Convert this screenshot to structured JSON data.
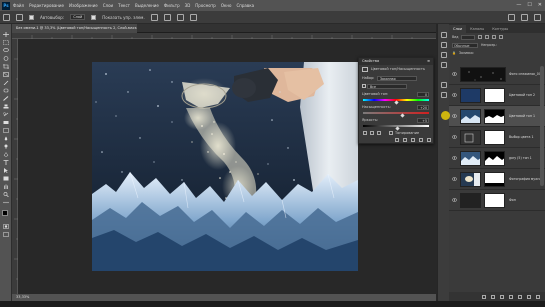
{
  "menu": {
    "items": [
      "Файл",
      "Редактирование",
      "Изображение",
      "Слои",
      "Текст",
      "Выделение",
      "Фильтр",
      "3D",
      "Просмотр",
      "Окно",
      "Справка"
    ],
    "window_controls": [
      "—",
      "☐",
      "✕"
    ]
  },
  "options": {
    "selection_label": "Автовыбор:",
    "selection_value": "Слой",
    "show_transform": "Показать упр. элем."
  },
  "document": {
    "tab_title": "Без имени-1 @ 33,3% (Цветовой тон/Насыщенность 2, Слой-маска/8) *",
    "status_text": "33,33%"
  },
  "properties": {
    "title": "Свойства",
    "subtitle": "Цветовой тон/Насыщенность",
    "preset_label": "Набор:",
    "preset_value": "Заказная",
    "channel_value": "Все",
    "hue_label": "Цветовой тон:",
    "hue_value": "0",
    "saturation_label": "Насыщенность:",
    "saturation_value": "+20",
    "lightness_label": "Яркость:",
    "lightness_value": "+5",
    "colorize_label": "Тонирование",
    "saturation_fraction": 0.6,
    "lightness_fraction": 0.53,
    "hue_fraction": 0.5
  },
  "layers_panel": {
    "tabs": [
      "Слои",
      "Каналы",
      "Контуры"
    ],
    "filter_label": "Вид",
    "blend_mode": "Обычные",
    "opacity_label": "Непрозр.:",
    "fill_label": "Заливка:",
    "layers": [
      {
        "name": "Фото снежинок_0001",
        "selected": false
      },
      {
        "name": "Цветовой тон 2",
        "selected": false
      },
      {
        "name": "Цветовой тон 1",
        "selected": true
      },
      {
        "name": "Выбор цвета 1",
        "selected": false
      },
      {
        "name": "gory (5) тон 1",
        "selected": false
      },
      {
        "name": "Фотография мужчины",
        "selected": false
      },
      {
        "name": "Фон",
        "selected": false
      }
    ]
  },
  "colors": {
    "accent": "#31a8ff",
    "ui_bg": "#535353",
    "panel_bg": "#3a3a3a"
  }
}
